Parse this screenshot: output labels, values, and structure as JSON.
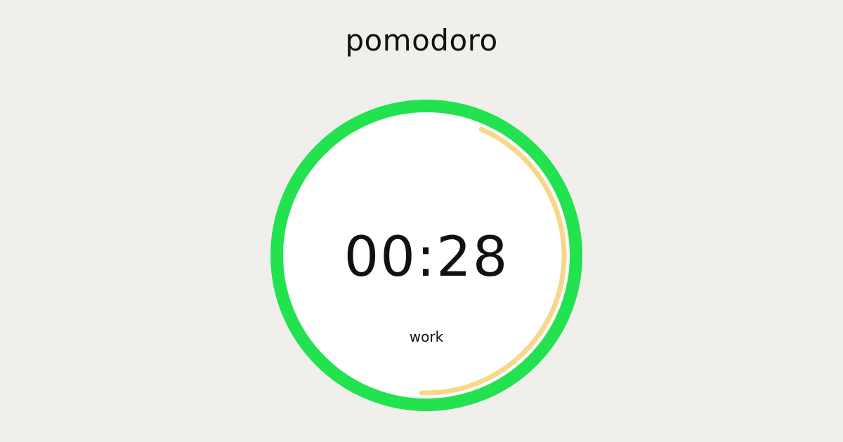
{
  "app": {
    "title": "pomodoro"
  },
  "timer": {
    "display": "00:28",
    "mode_label": "work",
    "inner_progress_fraction": 0.44,
    "outer_ring_fraction": 1.0
  },
  "colors": {
    "background": "#f0efeb",
    "outer_ring": "#22e24f",
    "inner_progress": "#f5d88a",
    "dial_face": "#ffffff",
    "text": "#111111"
  }
}
